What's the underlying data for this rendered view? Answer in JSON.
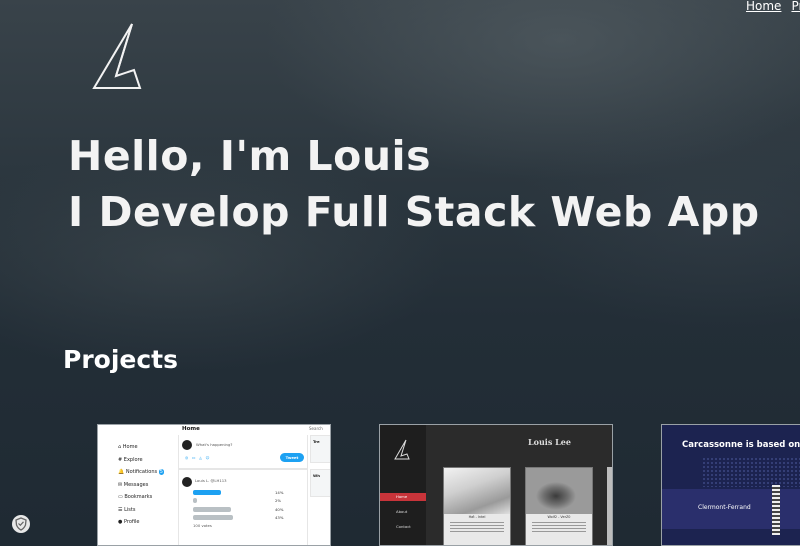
{
  "nav": {
    "items": [
      "Home",
      "Pr"
    ]
  },
  "hero": {
    "line1": "Hello, I'm Louis",
    "line2": "I Develop Full Stack Web App"
  },
  "projects": {
    "heading": "Projects",
    "card1": {
      "header": "Home",
      "search": "Search",
      "sidebar": [
        "Home",
        "Explore",
        "Notifications",
        "Messages",
        "Bookmarks",
        "Lists",
        "Profile"
      ],
      "notifications_count": "5",
      "compose_placeholder": "What's happening?",
      "tweet_button": "Tweet",
      "poll_user": "Louis L. @LH113",
      "poll_percents": [
        "14%",
        "2%",
        "40%",
        "43%"
      ],
      "votes": "100 votes",
      "right_boxes": [
        "Tre",
        "Wh"
      ]
    },
    "card2": {
      "title": "Louis Lee",
      "menu": [
        "Home",
        "About",
        "Contact"
      ],
      "captions": [
        "Hat́ - Intel",
        "Wolf2 - VerZ0"
      ]
    },
    "card3": {
      "title": "Carcassonne is based on which F",
      "city": "Clermont-Ferrand"
    }
  },
  "colors": {
    "accent_blue": "#1da1f2",
    "accent_red": "#c8343a"
  },
  "icons": {
    "logo": "stylized-A-logo-icon",
    "privacy": "shield-icon"
  }
}
